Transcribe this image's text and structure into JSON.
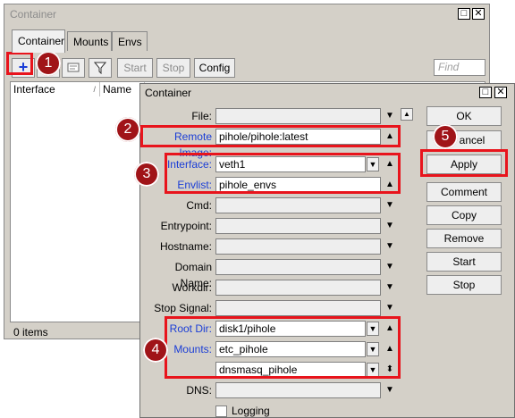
{
  "back_window": {
    "title": "Container",
    "tabs": [
      "Container",
      "Mounts",
      "Envs"
    ],
    "toolbar": {
      "add_symbol": "+",
      "start_label": "Start",
      "stop_label": "Stop",
      "config_label": "Config",
      "find_placeholder": "Find"
    },
    "columns": [
      "Interface",
      "Name"
    ],
    "status": "0 items"
  },
  "dialog": {
    "title": "Container",
    "fields": {
      "file": {
        "label": "File:",
        "value": ""
      },
      "remote_image": {
        "label": "Remote Image:",
        "value": "pihole/pihole:latest"
      },
      "interface": {
        "label": "Interface:",
        "value": "veth1"
      },
      "envlist": {
        "label": "Envlist:",
        "value": "pihole_envs"
      },
      "cmd": {
        "label": "Cmd:",
        "value": ""
      },
      "entrypoint": {
        "label": "Entrypoint:",
        "value": ""
      },
      "hostname": {
        "label": "Hostname:",
        "value": ""
      },
      "domain_name": {
        "label": "Domain Name:",
        "value": ""
      },
      "workdir": {
        "label": "Workdir:",
        "value": ""
      },
      "stop_signal": {
        "label": "Stop Signal:",
        "value": ""
      },
      "root_dir": {
        "label": "Root Dir:",
        "value": "disk1/pihole"
      },
      "mounts": {
        "label": "Mounts:",
        "value": "etc_pihole",
        "value2": "dnsmasq_pihole"
      },
      "dns": {
        "label": "DNS:",
        "value": ""
      },
      "logging": {
        "label": "Logging"
      }
    },
    "buttons": {
      "ok": "OK",
      "cancel": "ancel",
      "apply": "Apply",
      "comment": "Comment",
      "copy": "Copy",
      "remove": "Remove",
      "start": "Start",
      "stop": "Stop"
    }
  },
  "annotations": [
    "1",
    "2",
    "3",
    "4",
    "5"
  ],
  "colors": {
    "annotation_red": "#e8141c",
    "badge_red": "#a01418",
    "label_blue": "#1a3dd6",
    "add_blue": "#1a3dd6"
  }
}
